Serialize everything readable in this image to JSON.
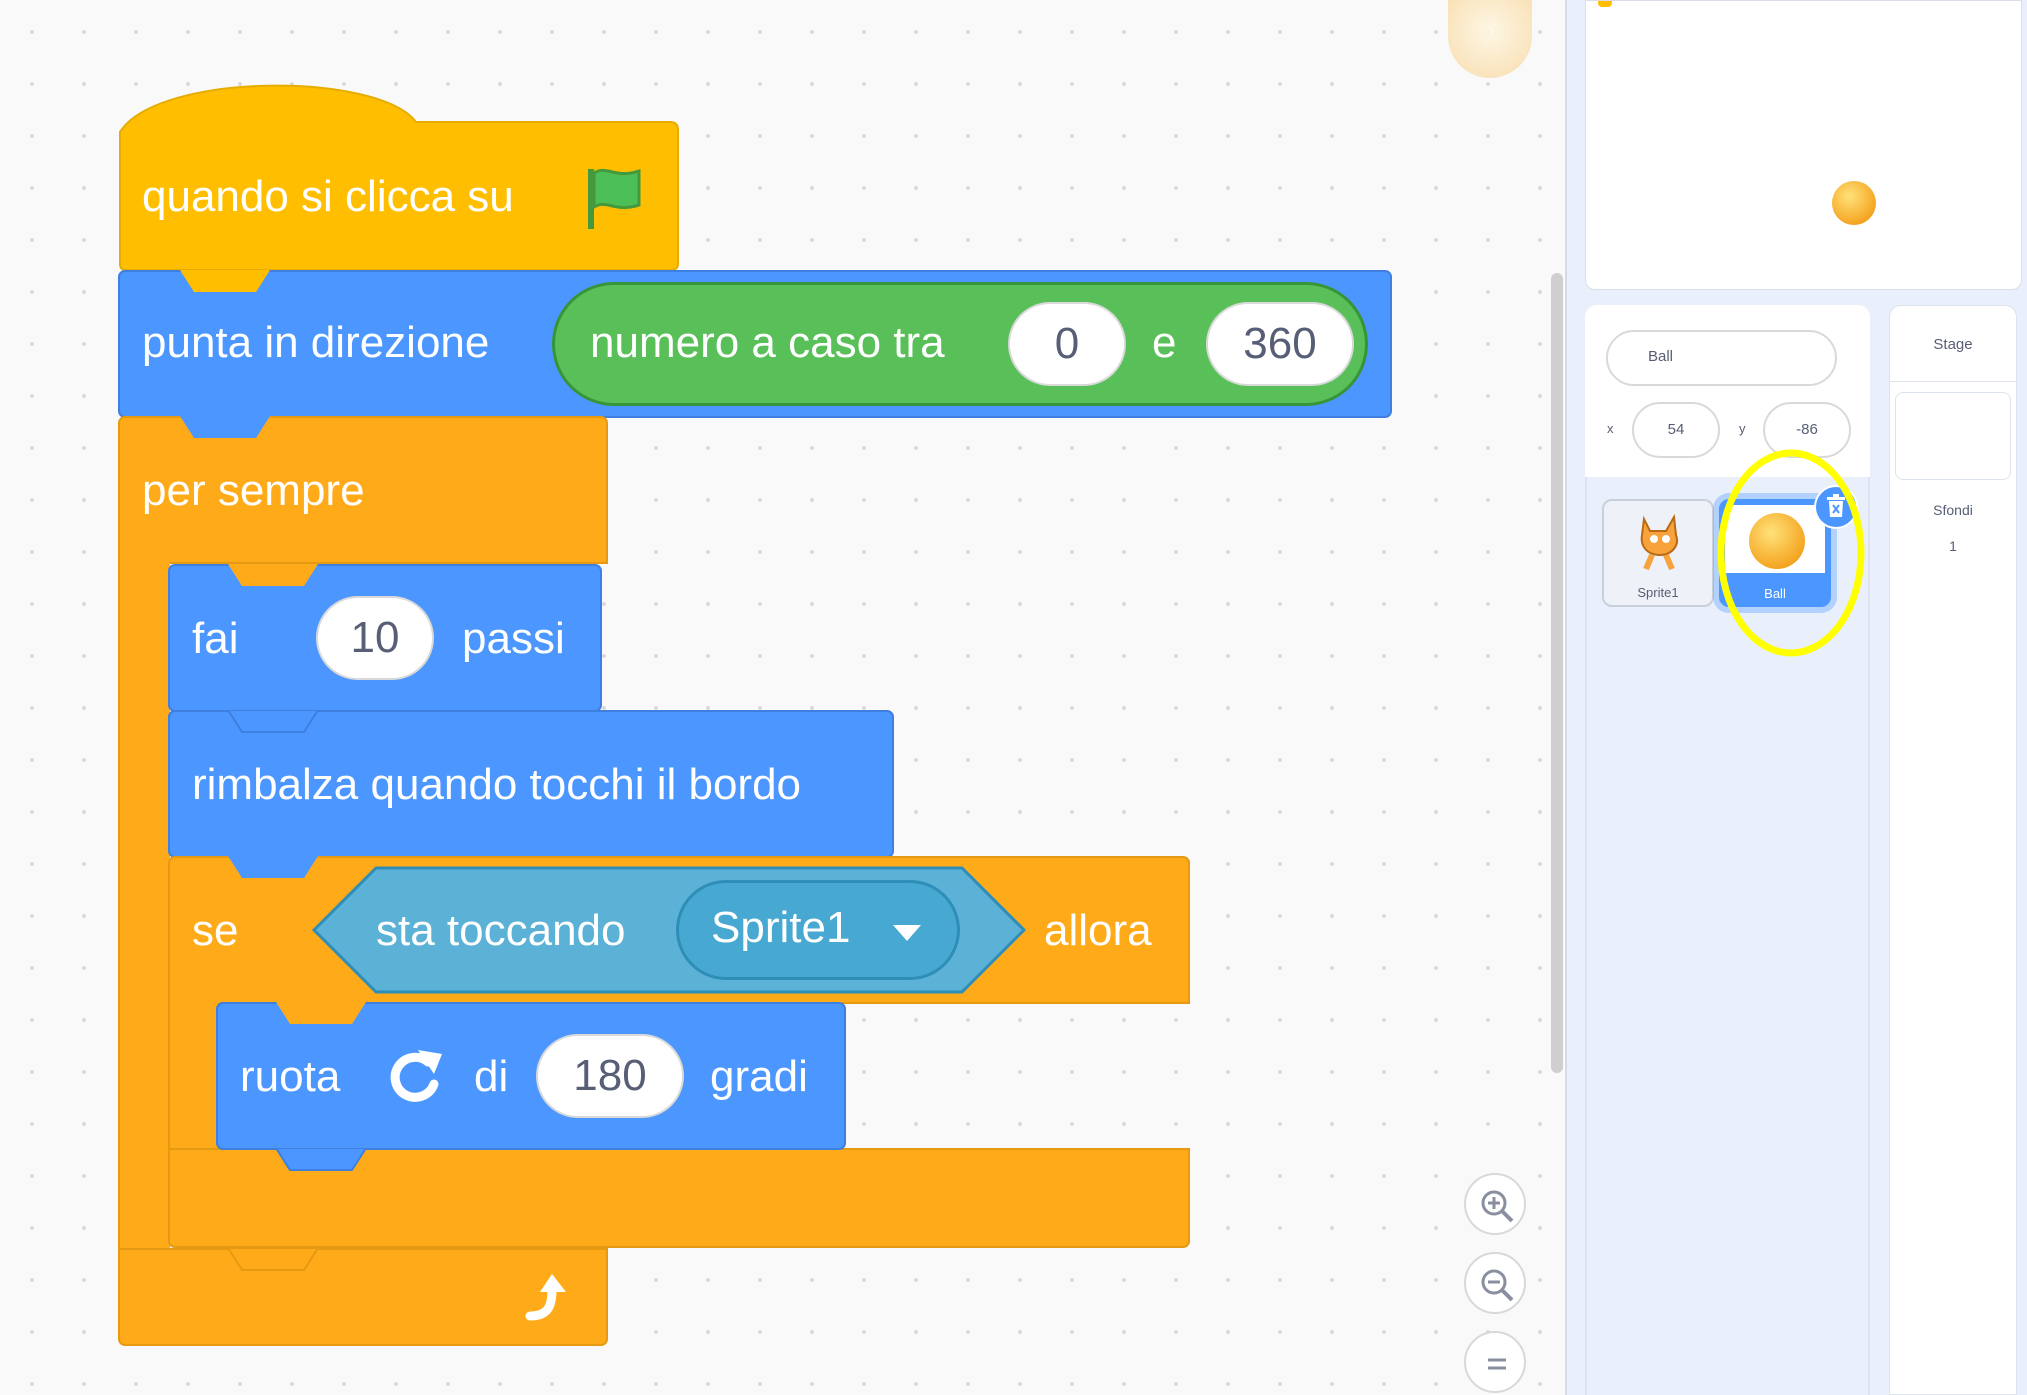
{
  "blocks": {
    "when_flag": {
      "label": "quando si clicca su"
    },
    "point_direction": {
      "label": "punta in direzione",
      "random_label": "numero a caso tra",
      "from": "0",
      "and": "e",
      "to": "360"
    },
    "forever": {
      "label": "per sempre"
    },
    "move": {
      "label1": "fai",
      "steps": "10",
      "label2": "passi"
    },
    "bounce": {
      "label": "rimbalza quando tocchi il bordo"
    },
    "if": {
      "label1": "se",
      "label2": "allora"
    },
    "touching": {
      "label": "sta toccando",
      "target": "Sprite1"
    },
    "turn": {
      "label1": "ruota",
      "label2": "di",
      "degrees": "180",
      "label3": "gradi"
    }
  },
  "sprite_info": {
    "name": "Ball",
    "x_label": "x",
    "x_value": "54",
    "y_label": "y",
    "y_value": "-86"
  },
  "sprites": [
    {
      "name": "Sprite1",
      "selected": false
    },
    {
      "name": "Ball",
      "selected": true
    }
  ],
  "stage_panel": {
    "title": "Stage",
    "backdrops_label": "Sfondi",
    "backdrops_count": "1"
  },
  "colors": {
    "motion": "#4c97ff",
    "control": "#ffab19",
    "events": "#ffbf00",
    "operators": "#59c059",
    "sensing": "#5cb1d6",
    "highlight": "#ffff00"
  }
}
